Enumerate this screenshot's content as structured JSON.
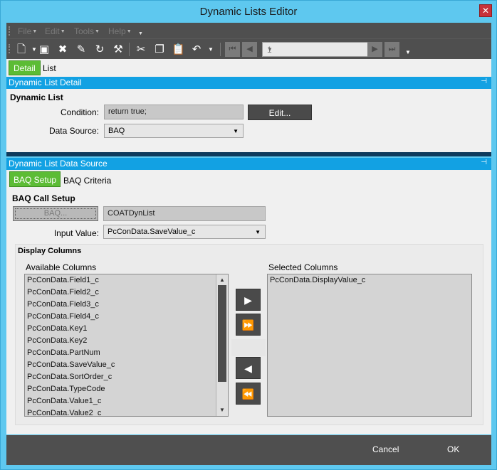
{
  "window": {
    "title": "Dynamic Lists Editor"
  },
  "menu": {
    "items": [
      "File",
      "Edit",
      "Tools",
      "Help"
    ]
  },
  "toolbar": {
    "icons": [
      "new-icon",
      "save-icon",
      "delete-icon",
      "clear-icon",
      "refresh-icon",
      "broom-icon",
      "cut-icon",
      "copy-icon",
      "paste-icon",
      "undo-icon"
    ],
    "record_value": "1"
  },
  "main_tabs": {
    "detail": "Detail",
    "list": "List"
  },
  "detail_panel": {
    "header": "Dynamic List Detail",
    "section_title": "Dynamic List",
    "condition_label": "Condition:",
    "condition_value": "return true;",
    "edit_button": "Edit...",
    "data_source_label": "Data Source:",
    "data_source_value": "BAQ"
  },
  "ds_panel": {
    "header": "Dynamic List Data Source",
    "tabs": {
      "setup": "BAQ Setup",
      "criteria": "BAQ Criteria"
    },
    "call_setup_title": "BAQ Call Setup",
    "baq_button": "BAQ...",
    "baq_value": "COATDynList",
    "input_value_label": "Input Value:",
    "input_value": "PcConData.SaveValue_c",
    "display_columns_title": "Display Columns",
    "available_label": "Available Columns",
    "selected_label": "Selected Columns",
    "available_columns": [
      "PcConData.Field1_c",
      "PcConData.Field2_c",
      "PcConData.Field3_c",
      "PcConData.Field4_c",
      "PcConData.Key1",
      "PcConData.Key2",
      "PcConData.PartNum",
      "PcConData.SaveValue_c",
      "PcConData.SortOrder_c",
      "PcConData.TypeCode",
      "PcConData.Value1_c",
      "PcConData.Value2_c"
    ],
    "selected_columns": [
      "PcConData.DisplayValue_c"
    ]
  },
  "footer": {
    "cancel": "Cancel",
    "ok": "OK"
  }
}
